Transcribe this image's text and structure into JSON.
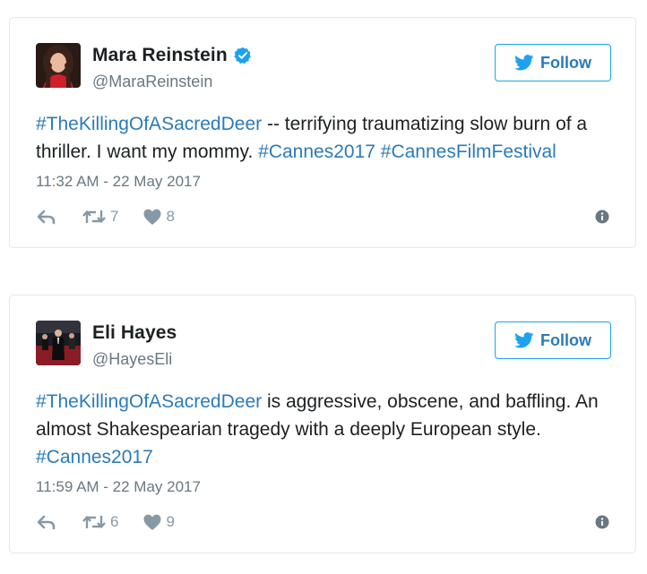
{
  "tweets": [
    {
      "display_name": "Mara Reinstein",
      "verified": true,
      "handle": "@MaraReinstein",
      "follow_label": "Follow",
      "text_segments": [
        {
          "text": "#TheKillingOfASacredDeer",
          "type": "hashtag"
        },
        {
          "text": " -- terrifying traumatizing slow burn of a thriller. I want my mommy. ",
          "type": "plain"
        },
        {
          "text": "#Cannes2017",
          "type": "hashtag"
        },
        {
          "text": " ",
          "type": "plain"
        },
        {
          "text": "#CannesFilmFestival",
          "type": "hashtag"
        }
      ],
      "timestamp": "11:32 AM - 22 May 2017",
      "retweets": "7",
      "likes": "8"
    },
    {
      "display_name": "Eli Hayes",
      "verified": false,
      "handle": "@HayesEli",
      "follow_label": "Follow",
      "text_segments": [
        {
          "text": "#TheKillingOfASacredDeer",
          "type": "hashtag"
        },
        {
          "text": " is aggressive, obscene, and baffling. An almost Shakespearian tragedy with a deeply European style. ",
          "type": "plain"
        },
        {
          "text": "#Cannes2017",
          "type": "hashtag"
        }
      ],
      "timestamp": "11:59 AM - 22 May 2017",
      "retweets": "6",
      "likes": "9"
    }
  ],
  "icons": {
    "reply": "reply-icon",
    "retweet": "retweet-icon",
    "like": "heart-icon",
    "info": "info-icon",
    "verified": "verified-badge-icon",
    "follow": "twitter-bird-icon"
  },
  "colors": {
    "link": "#2b7bb9",
    "follow_border": "#1da1f2",
    "verified": "#1da1f2",
    "muted": "#697882",
    "action": "#8899a6",
    "text": "#1c2022",
    "card_border": "#e1e8ed"
  }
}
